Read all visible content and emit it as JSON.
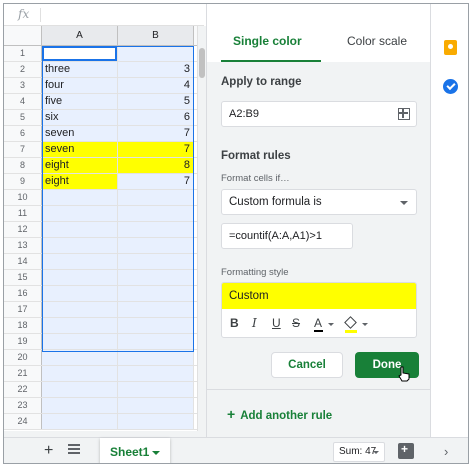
{
  "formula_bar": {
    "fx_label": "fx"
  },
  "sheet": {
    "columns": [
      "A",
      "B"
    ],
    "rows": [
      {
        "n": "1",
        "a": "",
        "b": ""
      },
      {
        "n": "2",
        "a": "three",
        "b": "3"
      },
      {
        "n": "3",
        "a": "four",
        "b": "4"
      },
      {
        "n": "4",
        "a": "five",
        "b": "5"
      },
      {
        "n": "5",
        "a": "six",
        "b": "6"
      },
      {
        "n": "6",
        "a": "seven",
        "b": "7"
      },
      {
        "n": "7",
        "a": "seven",
        "b": "7"
      },
      {
        "n": "8",
        "a": "eight",
        "b": "8"
      },
      {
        "n": "9",
        "a": "eight",
        "b": "7"
      },
      {
        "n": "10",
        "a": "",
        "b": ""
      },
      {
        "n": "11",
        "a": "",
        "b": ""
      },
      {
        "n": "12",
        "a": "",
        "b": ""
      },
      {
        "n": "13",
        "a": "",
        "b": ""
      },
      {
        "n": "14",
        "a": "",
        "b": ""
      },
      {
        "n": "15",
        "a": "",
        "b": ""
      },
      {
        "n": "16",
        "a": "",
        "b": ""
      },
      {
        "n": "17",
        "a": "",
        "b": ""
      },
      {
        "n": "18",
        "a": "",
        "b": ""
      },
      {
        "n": "19",
        "a": "",
        "b": ""
      },
      {
        "n": "20",
        "a": "",
        "b": ""
      },
      {
        "n": "21",
        "a": "",
        "b": ""
      },
      {
        "n": "22",
        "a": "",
        "b": ""
      },
      {
        "n": "23",
        "a": "",
        "b": ""
      },
      {
        "n": "24",
        "a": "",
        "b": ""
      }
    ],
    "highlight_color": "#ffff00",
    "selection_color": "#e8f0fe"
  },
  "tabbar": {
    "add_label": "+",
    "sheet_tab": "Sheet1",
    "sum_label": "Sum: 47"
  },
  "panel": {
    "tab_single": "Single color",
    "tab_scale": "Color scale",
    "apply_title": "Apply to range",
    "range_value": "A2:B9",
    "format_rules_title": "Format rules",
    "format_cells_if": "Format cells if…",
    "condition": "Custom formula is",
    "formula_value": "=countif(A:A,A1)>1",
    "formatting_style_label": "Formatting style",
    "style_preview": "Custom",
    "toolbar": {
      "bold": "B",
      "italic": "I",
      "underline": "U",
      "strike": "S",
      "text_color": "A"
    },
    "cancel_label": "Cancel",
    "done_label": "Done",
    "add_rule_label": "Add another rule",
    "accent_color": "#188038"
  },
  "sidebar": {
    "icons": [
      "keep-icon",
      "tasks-icon"
    ]
  }
}
